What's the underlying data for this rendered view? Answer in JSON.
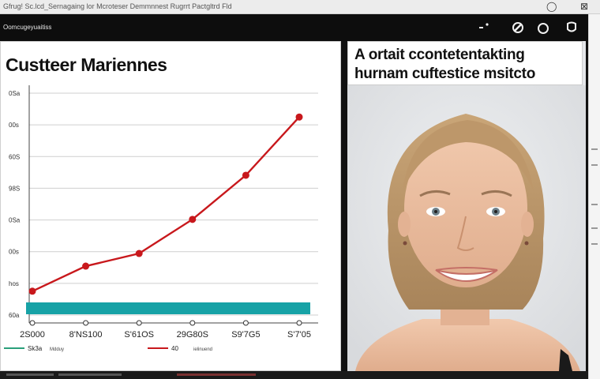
{
  "window": {
    "title": "Gfrug! Sc.lcd_Sernagaing lor Mcroteser Demmnnest Rugrrt Pactgltrd Fld",
    "controls": [
      "◯",
      "⊠"
    ]
  },
  "toolbar": {
    "name": "Oomcugeyuaitiss",
    "icons": [
      "more-icon",
      "edit-icon",
      "circle-icon",
      "shield-icon"
    ]
  },
  "chart_data": {
    "type": "line",
    "title": "Custteer Mariennes",
    "categories": [
      "2S000",
      "8'NS100",
      "S'61OS",
      "29G80S",
      "S9'7G5",
      "S'7'05"
    ],
    "y_ticks": [
      "0Sa",
      "00s",
      "60S",
      "98S",
      "0Sa",
      "00s",
      "hos",
      "60a"
    ],
    "values": [
      100,
      205,
      258,
      401,
      586,
      830
    ],
    "baseline_series": {
      "name": "",
      "color": "#17a2a6"
    },
    "series_color": "#c8181c",
    "ylim": [
      0,
      930
    ],
    "ylabel": "",
    "legend": [
      {
        "label": "Sk3a",
        "sub": "Mdduy",
        "color": "#2aa07a"
      },
      {
        "label": "40",
        "sub": "ielinuend",
        "color": "#c8181c"
      }
    ],
    "grid": true
  },
  "photo": {
    "caption_line1": "A ortait ccontetentakting",
    "caption_line2": "hurnam cuftestice msitcto",
    "subject": "smiling-woman-portrait"
  },
  "colors": {
    "frame": "#111111",
    "accent_line": "#c8181c",
    "baseline": "#17a2a6"
  }
}
